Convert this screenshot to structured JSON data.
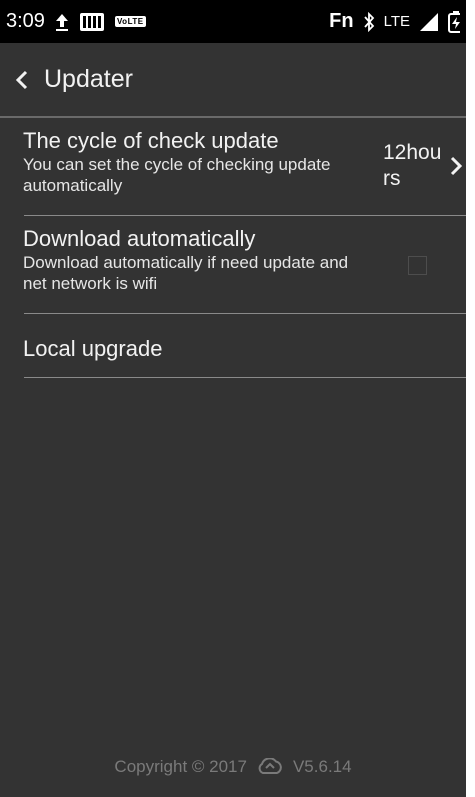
{
  "status_bar": {
    "time": "3:09",
    "volte": "VoLTE",
    "fn": "Fn",
    "network": "LTE"
  },
  "header": {
    "title": "Updater"
  },
  "settings": {
    "cycle": {
      "title": "The cycle of check update",
      "summary": "You can set the cycle of checking update automatically",
      "value": "12hours"
    },
    "download": {
      "title": "Download automatically",
      "summary": "Download automatically if need update and net network is wifi",
      "checked": false
    },
    "local": {
      "title": "Local upgrade"
    }
  },
  "footer": {
    "copyright": "Copyright © 2017",
    "version": "V5.6.14"
  },
  "colors": {
    "background": "#333333",
    "status_bar": "#000000",
    "divider": "#8a8a8a",
    "footer_text": "#7a7a7a"
  }
}
